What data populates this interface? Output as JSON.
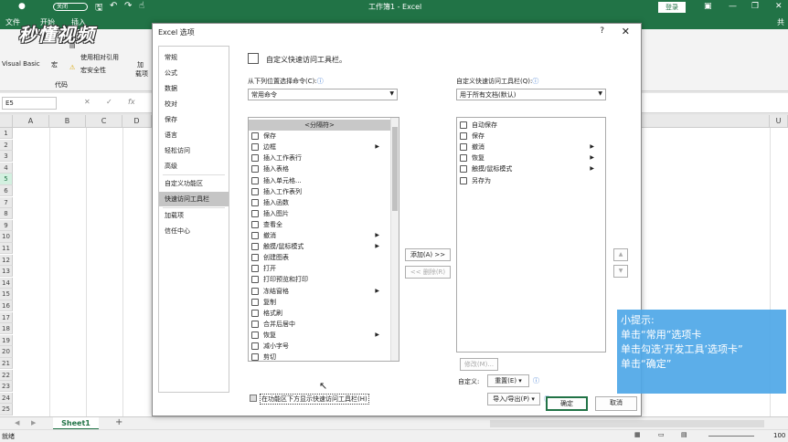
{
  "titlebar": {
    "autosave_label": "关闭",
    "window_title": "工作簿1 - Excel",
    "login_label": "登录"
  },
  "tabs": {
    "file": "文件",
    "start": "开始",
    "insert": "插入",
    "share": "共"
  },
  "ribbon": {
    "visual_basic": "Visual Basic",
    "macro": "宏",
    "relative_ref": "使用相对引用",
    "macro_security": "宏安全性",
    "group_code": "代码",
    "addin_short": "加",
    "addin_label": "载项"
  },
  "watermark": "秒懂视频",
  "formulabar": {
    "namebox": "E5",
    "cancel": "✕",
    "enter": "✓",
    "fx": "fx"
  },
  "grid": {
    "columns": [
      "A",
      "B",
      "C",
      "D",
      "U"
    ],
    "rows": [
      "1",
      "2",
      "3",
      "4",
      "5",
      "6",
      "7",
      "8",
      "9",
      "10",
      "11",
      "12",
      "13",
      "14",
      "15",
      "16",
      "17",
      "18",
      "19",
      "20",
      "21",
      "22",
      "23",
      "24",
      "25"
    ],
    "selected_row": "5"
  },
  "sheetbar": {
    "sheet1": "Sheet1",
    "add": "+"
  },
  "statusbar": {
    "ready": "就绪",
    "zoom": "100"
  },
  "dialog": {
    "title": "Excel 选项",
    "help": "?",
    "close": "✕",
    "categories": [
      "常规",
      "公式",
      "数据",
      "校对",
      "保存",
      "语言",
      "轻松访问",
      "高级",
      "自定义功能区",
      "快速访问工具栏",
      "加载项",
      "信任中心"
    ],
    "selected_category": "快速访问工具栏",
    "header": "自定义快速访问工具栏。",
    "choose_from_label": "从下列位置选择命令(C):",
    "choose_from_value": "常用命令",
    "customize_label": "自定义快速访问工具栏(Q):",
    "customize_value": "用于所有文档(默认)",
    "left_list": [
      {
        "label": "<分隔符>",
        "sep": true
      },
      {
        "label": "保存"
      },
      {
        "label": "边框",
        "sub": true
      },
      {
        "label": "插入工作表行"
      },
      {
        "label": "插入表格"
      },
      {
        "label": "插入单元格..."
      },
      {
        "label": "插入工作表列"
      },
      {
        "label": "插入函数"
      },
      {
        "label": "插入图片"
      },
      {
        "label": "查看全"
      },
      {
        "label": "撤消",
        "sub": true
      },
      {
        "label": "触摸/鼠标模式",
        "sub": true
      },
      {
        "label": "创建图表"
      },
      {
        "label": "打开"
      },
      {
        "label": "打印预览和打印"
      },
      {
        "label": "冻结窗格",
        "sub": true
      },
      {
        "label": "复制"
      },
      {
        "label": "格式刷"
      },
      {
        "label": "合并后居中"
      },
      {
        "label": "恢复",
        "sub": true
      },
      {
        "label": "减小字号"
      },
      {
        "label": "剪切"
      }
    ],
    "right_list": [
      {
        "label": "自动保存"
      },
      {
        "label": "保存"
      },
      {
        "label": "撤消",
        "sub": true
      },
      {
        "label": "恢复",
        "sub": true
      },
      {
        "label": "触摸/鼠标模式",
        "sub": true
      },
      {
        "label": "另存为"
      }
    ],
    "add_button": "添加(A) >>",
    "remove_button": "<< 删除(R)",
    "modify_button": "修改(M)...",
    "customize_label2": "自定义:",
    "reset_button": "重置(E) ▾",
    "import_export_button": "导入/导出(P) ▾",
    "show_below_label": "在功能区下方显示快速访问工具栏(H)",
    "ok_button": "确定",
    "cancel_button": "取消",
    "up_arrow": "▲",
    "down_arrow": "▼"
  },
  "tip": {
    "line1": "小提示:",
    "line2": "单击“常用”选项卡",
    "line3": "单击勾选‘开发工具’选项卡”",
    "line4": "单击“确定”"
  },
  "colors": {
    "excel_green": "#217346",
    "tip_blue": "#4fa8e8"
  }
}
